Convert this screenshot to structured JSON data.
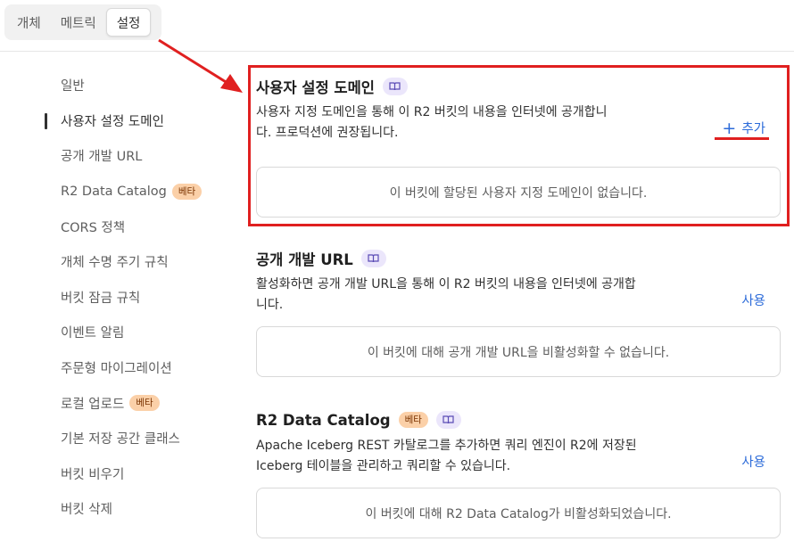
{
  "tabs": [
    {
      "label": "개체"
    },
    {
      "label": "메트릭"
    },
    {
      "label": "설정"
    }
  ],
  "sidebar": {
    "items": [
      {
        "label": "일반"
      },
      {
        "label": "사용자 설정 도메인"
      },
      {
        "label": "공개 개발 URL"
      },
      {
        "label": "R2 Data Catalog",
        "badge": "베타"
      },
      {
        "label": "CORS 정책"
      },
      {
        "label": "개체 수명 주기 규칙"
      },
      {
        "label": "버킷 잠금 규칙"
      },
      {
        "label": "이벤트 알림"
      },
      {
        "label": "주문형 마이그레이션"
      },
      {
        "label": "로컬 업로드",
        "badge": "베타"
      },
      {
        "label": "기본 저장 공간 클래스"
      },
      {
        "label": "버킷 비우기"
      },
      {
        "label": "버킷 삭제"
      }
    ]
  },
  "sections": {
    "custom_domain": {
      "title": "사용자 설정 도메인",
      "desc_line1": "사용자 지정 도메인을 통해 이 R2 버킷의 내용을 인터넷에 공개합니",
      "desc_line2": "다. 프로덕션에 권장됩니다.",
      "action": "추가",
      "action_icon": "+",
      "empty": "이 버킷에 할당된 사용자 지정 도메인이 없습니다."
    },
    "public_dev_url": {
      "title": "공개 개발 URL",
      "desc_line1": "활성화하면 공개 개발 URL을 통해 이 R2 버킷의 내용을 인터넷에 공개합",
      "desc_line2": "니다.",
      "action": "사용",
      "empty": "이 버킷에 대해 공개 개발 URL을 비활성화할 수 없습니다."
    },
    "data_catalog": {
      "title": "R2 Data Catalog",
      "badge": "베타",
      "desc_line1": "Apache Iceberg REST 카탈로그를 추가하면 쿼리 엔진이 R2에 저장된",
      "desc_line2": "Iceberg 테이블을 관리하고 쿼리할 수 있습니다.",
      "action": "사용",
      "empty": "이 버킷에 대해 R2 Data Catalog가 비활성화되었습니다."
    }
  },
  "icons": {
    "doc": "book-icon",
    "add": "plus-icon"
  },
  "colors": {
    "accent": "#2c6bd9",
    "annotation": "#e02020",
    "badge_bg": "#fbd0a8",
    "doc_badge_bg": "#ebe6fb"
  }
}
